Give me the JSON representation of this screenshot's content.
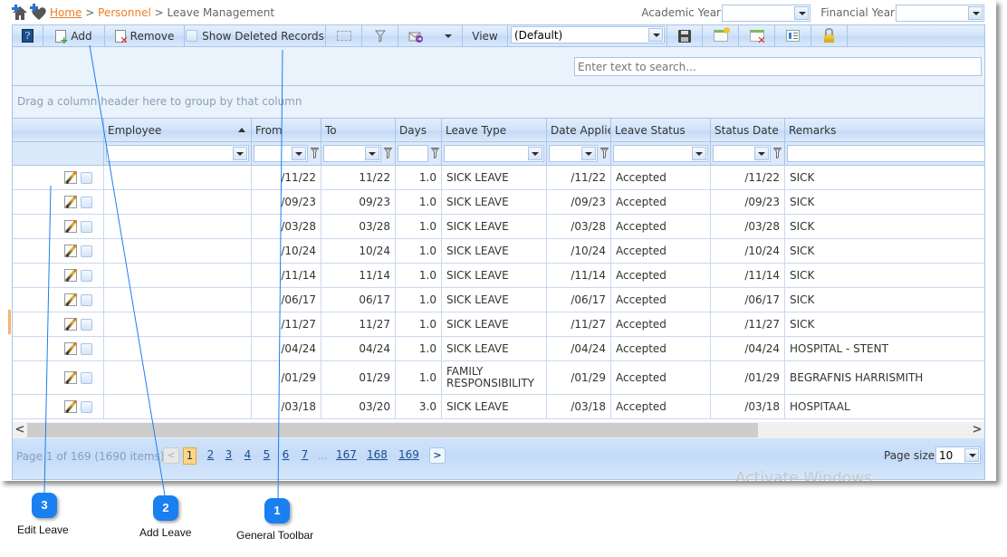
{
  "breadcrumb": {
    "home": "Home",
    "sep1": ">",
    "section": "Personnel",
    "sep2": ">",
    "page": "Leave Management"
  },
  "filters": {
    "academic_year_label": "Academic Year",
    "academic_year_value": "",
    "financial_year_label": "Financial Year",
    "financial_year_value": ""
  },
  "toolbar": {
    "help_icon": "help-book-icon",
    "add_label": "Add",
    "remove_label": "Remove",
    "show_deleted_label": "Show Deleted Records",
    "view_label": "View",
    "view_value": "(Default)"
  },
  "search": {
    "placeholder": "Enter text to search..."
  },
  "group_panel": {
    "hint": "Drag a column header here to group by that column"
  },
  "grid": {
    "columns": [
      {
        "key": "employee",
        "label": "Employee",
        "sorted": "asc"
      },
      {
        "key": "from",
        "label": "From"
      },
      {
        "key": "to",
        "label": "To"
      },
      {
        "key": "days",
        "label": "Days"
      },
      {
        "key": "leave_type",
        "label": "Leave Type"
      },
      {
        "key": "date_applied",
        "label": "Date Applied"
      },
      {
        "key": "leave_status",
        "label": "Leave Status"
      },
      {
        "key": "status_date",
        "label": "Status Date"
      },
      {
        "key": "remarks",
        "label": "Remarks"
      }
    ],
    "rows": [
      {
        "employee": "",
        "from": "/11/22",
        "to": "11/22",
        "days": "1.0",
        "leave_type": "SICK LEAVE",
        "date_applied": "/11/22",
        "leave_status": "Accepted",
        "status_date": "/11/22",
        "remarks": "SICK"
      },
      {
        "employee": "",
        "from": "/09/23",
        "to": "09/23",
        "days": "1.0",
        "leave_type": "SICK LEAVE",
        "date_applied": "/09/23",
        "leave_status": "Accepted",
        "status_date": "/09/23",
        "remarks": "SICK"
      },
      {
        "employee": "",
        "from": "/03/28",
        "to": "03/28",
        "days": "1.0",
        "leave_type": "SICK LEAVE",
        "date_applied": "/03/28",
        "leave_status": "Accepted",
        "status_date": "/03/28",
        "remarks": "SICK"
      },
      {
        "employee": "",
        "from": "/10/24",
        "to": "10/24",
        "days": "1.0",
        "leave_type": "SICK LEAVE",
        "date_applied": "/10/24",
        "leave_status": "Accepted",
        "status_date": "/10/24",
        "remarks": "SICK"
      },
      {
        "employee": "",
        "from": "/11/14",
        "to": "11/14",
        "days": "1.0",
        "leave_type": "SICK LEAVE",
        "date_applied": "/11/14",
        "leave_status": "Accepted",
        "status_date": "/11/14",
        "remarks": "SICK"
      },
      {
        "employee": "",
        "from": "/06/17",
        "to": "06/17",
        "days": "1.0",
        "leave_type": "SICK LEAVE",
        "date_applied": "/06/17",
        "leave_status": "Accepted",
        "status_date": "/06/17",
        "remarks": "SICK"
      },
      {
        "employee": "",
        "from": "/11/27",
        "to": "11/27",
        "days": "1.0",
        "leave_type": "SICK LEAVE",
        "date_applied": "/11/27",
        "leave_status": "Accepted",
        "status_date": "/11/27",
        "remarks": "SICK"
      },
      {
        "employee": "",
        "from": "/04/24",
        "to": "04/24",
        "days": "1.0",
        "leave_type": "SICK LEAVE",
        "date_applied": "/04/24",
        "leave_status": "Accepted",
        "status_date": "/04/24",
        "remarks": "HOSPITAL - STENT"
      },
      {
        "employee": "",
        "from": "/01/29",
        "to": "01/29",
        "days": "1.0",
        "leave_type": "FAMILY RESPONSIBILITY",
        "date_applied": "/01/29",
        "leave_status": "Accepted",
        "status_date": "/01/29",
        "remarks": "BEGRAFNIS HARRISMITH"
      },
      {
        "employee": "",
        "from": "/03/18",
        "to": "03/20",
        "days": "3.0",
        "leave_type": "SICK LEAVE",
        "date_applied": "/03/18",
        "leave_status": "Accepted",
        "status_date": "/03/18",
        "remarks": "HOSPITAAL"
      }
    ]
  },
  "pager": {
    "summary": "Page 1 of 169 (1690 items)",
    "current_page": "1",
    "pages": [
      "1",
      "2",
      "3",
      "4",
      "5",
      "6",
      "7"
    ],
    "ellipsis": "...",
    "last_pages": [
      "167",
      "168",
      "169"
    ],
    "prev": "<",
    "next": ">",
    "page_size_label": "Page size:",
    "page_size_value": "10"
  },
  "scrollbar": {
    "left": "<",
    "right": ">"
  },
  "watermark": "Activate Windows",
  "annotations": [
    {
      "number": "1",
      "label": "General Toolbar"
    },
    {
      "number": "2",
      "label": "Add Leave"
    },
    {
      "number": "3",
      "label": "Edit Leave"
    }
  ],
  "colors": {
    "accent_orange": "#ef7d22",
    "grid_border": "#a8c5e8",
    "callout_blue": "#1a7ff0",
    "current_page": "#fbd68a"
  }
}
